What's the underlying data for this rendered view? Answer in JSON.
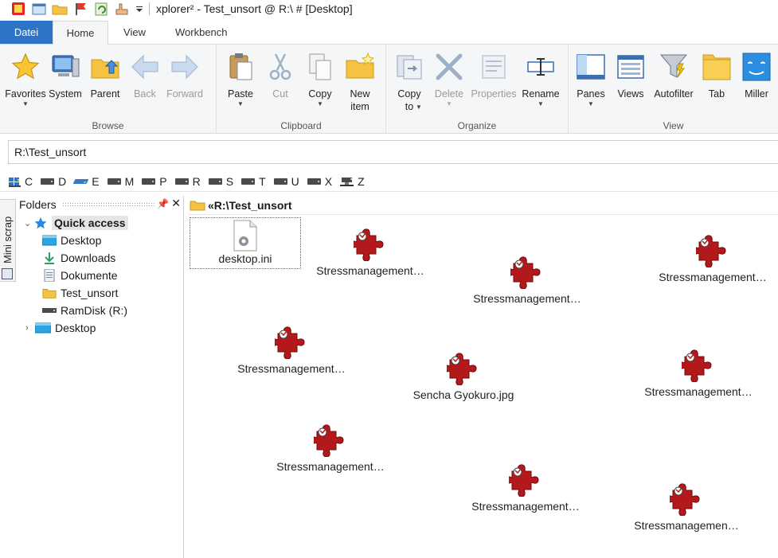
{
  "window": {
    "title": "xplorer² - Test_unsort @ R:\\ # [Desktop]"
  },
  "ribbon_tabs": [
    {
      "label": "Datei",
      "type": "file"
    },
    {
      "label": "Home",
      "active": true
    },
    {
      "label": "View"
    },
    {
      "label": "Workbench"
    }
  ],
  "ribbon_groups": [
    {
      "label": "Browse",
      "buttons": [
        {
          "label": "Favorites",
          "icon": "star-icon",
          "dropdown": true
        },
        {
          "label": "System",
          "icon": "computer-icon"
        },
        {
          "label": "Parent",
          "icon": "folder-up-icon"
        },
        {
          "label": "Back",
          "icon": "arrow-left-icon",
          "disabled": true
        },
        {
          "label": "Forward",
          "icon": "arrow-right-icon",
          "disabled": true
        }
      ]
    },
    {
      "label": "Clipboard",
      "buttons": [
        {
          "label": "Paste",
          "icon": "paste-icon",
          "dropdown": true
        },
        {
          "label": "Cut",
          "icon": "scissors-icon",
          "disabled": true
        },
        {
          "label": "Copy",
          "icon": "copy-icon",
          "dropdown": true
        },
        {
          "label": "New item",
          "icon": "new-folder-icon"
        }
      ]
    },
    {
      "label": "Organize",
      "buttons": [
        {
          "label": "Copy to",
          "icon": "copy-to-icon",
          "dropdown": true
        },
        {
          "label": "Delete",
          "icon": "delete-icon",
          "disabled": true,
          "dropdown": true
        },
        {
          "label": "Properties",
          "icon": "properties-icon",
          "disabled": true
        },
        {
          "label": "Rename",
          "icon": "rename-icon",
          "dropdown": true
        }
      ]
    },
    {
      "label": "View",
      "buttons": [
        {
          "label": "Panes",
          "icon": "panes-icon",
          "dropdown": true
        },
        {
          "label": "Views",
          "icon": "views-icon"
        },
        {
          "label": "Autofilter",
          "icon": "filter-icon"
        },
        {
          "label": "Tab",
          "icon": "tab-icon"
        },
        {
          "label": "Miller",
          "icon": "miller-icon"
        }
      ]
    }
  ],
  "address": {
    "value": "R:\\Test_unsort"
  },
  "drives": [
    "C",
    "D",
    "E",
    "M",
    "P",
    "R",
    "S",
    "T",
    "U",
    "X",
    "Z"
  ],
  "folders_pane": {
    "title": "Folders",
    "nodes": [
      {
        "label": "Quick access",
        "icon": "star-icon",
        "expanded": true
      },
      {
        "label": "Desktop",
        "icon": "desktop-icon"
      },
      {
        "label": "Downloads",
        "icon": "download-icon"
      },
      {
        "label": "Dokumente",
        "icon": "document-icon"
      },
      {
        "label": "Test_unsort",
        "icon": "folder-icon"
      },
      {
        "label": "RamDisk (R:)",
        "icon": "drive-icon"
      },
      {
        "label": "Desktop",
        "icon": "desktop-icon",
        "collapsed": true
      }
    ]
  },
  "side_tab": {
    "label": "Mini scrap"
  },
  "main_pane": {
    "path_label": "R:\\Test_unsort",
    "path_prefix": "«",
    "files": [
      {
        "name": "desktop.ini",
        "icon": "settings-file-icon",
        "selected": true
      },
      {
        "name": "Stressmanagement…",
        "icon": "puzzle-icon"
      },
      {
        "name": "Stressmanagement…",
        "icon": "puzzle-icon"
      },
      {
        "name": "Stressmanagement…",
        "icon": "puzzle-icon"
      },
      {
        "name": "Stressmanagement…",
        "icon": "puzzle-icon"
      },
      {
        "name": "Sencha Gyokuro.jpg",
        "icon": "puzzle-icon"
      },
      {
        "name": "Stressmanagement…",
        "icon": "puzzle-icon"
      },
      {
        "name": "Stressmanagement…",
        "icon": "puzzle-icon"
      },
      {
        "name": "Stressmanagement…",
        "icon": "puzzle-icon"
      },
      {
        "name": "Stressmanagemen…",
        "icon": "puzzle-icon"
      }
    ]
  },
  "colors": {
    "file_tab": "#2b74c8",
    "puzzle": "#b3191b",
    "folder": "#f5c242"
  }
}
